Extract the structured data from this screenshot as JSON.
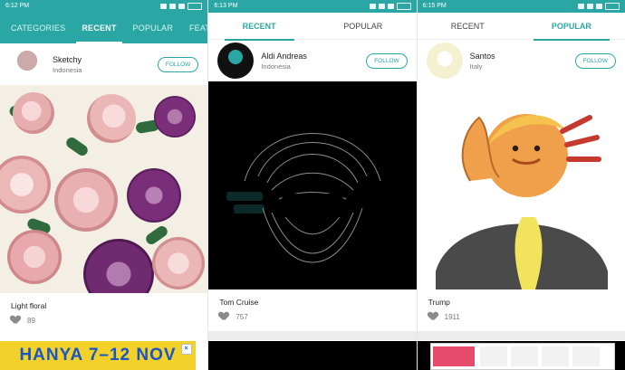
{
  "colors": {
    "teal": "#2aa7a5",
    "ad_yellow": "#f2d12a",
    "ad_blue": "#1a55c8"
  },
  "panels": [
    {
      "status_time": "6:12 PM",
      "tabs": [
        "CATEGORIES",
        "RECENT",
        "POPULAR",
        "FEATURED"
      ],
      "active_tab": "RECENT",
      "user": {
        "name": "Sketchy",
        "location": "Indonesia"
      },
      "follow_label": "FOLLOW",
      "post_title": "Light floral",
      "likes": "89",
      "ad_text": "HANYA 7–12 NOV"
    },
    {
      "status_time": "6:13 PM",
      "tabs": [
        "RECENT",
        "POPULAR"
      ],
      "active_tab": "RECENT",
      "user": {
        "name": "Aldi Andreas",
        "location": "Indonesia"
      },
      "follow_label": "FOLLOW",
      "post_title": "Tom Cruise",
      "likes": "757"
    },
    {
      "status_time": "6:15 PM",
      "tabs": [
        "RECENT",
        "POPULAR"
      ],
      "active_tab": "POPULAR",
      "user": {
        "name": "Santos",
        "location": "Italy"
      },
      "follow_label": "FOLLOW",
      "post_title": "Trump",
      "likes": "1911"
    }
  ]
}
